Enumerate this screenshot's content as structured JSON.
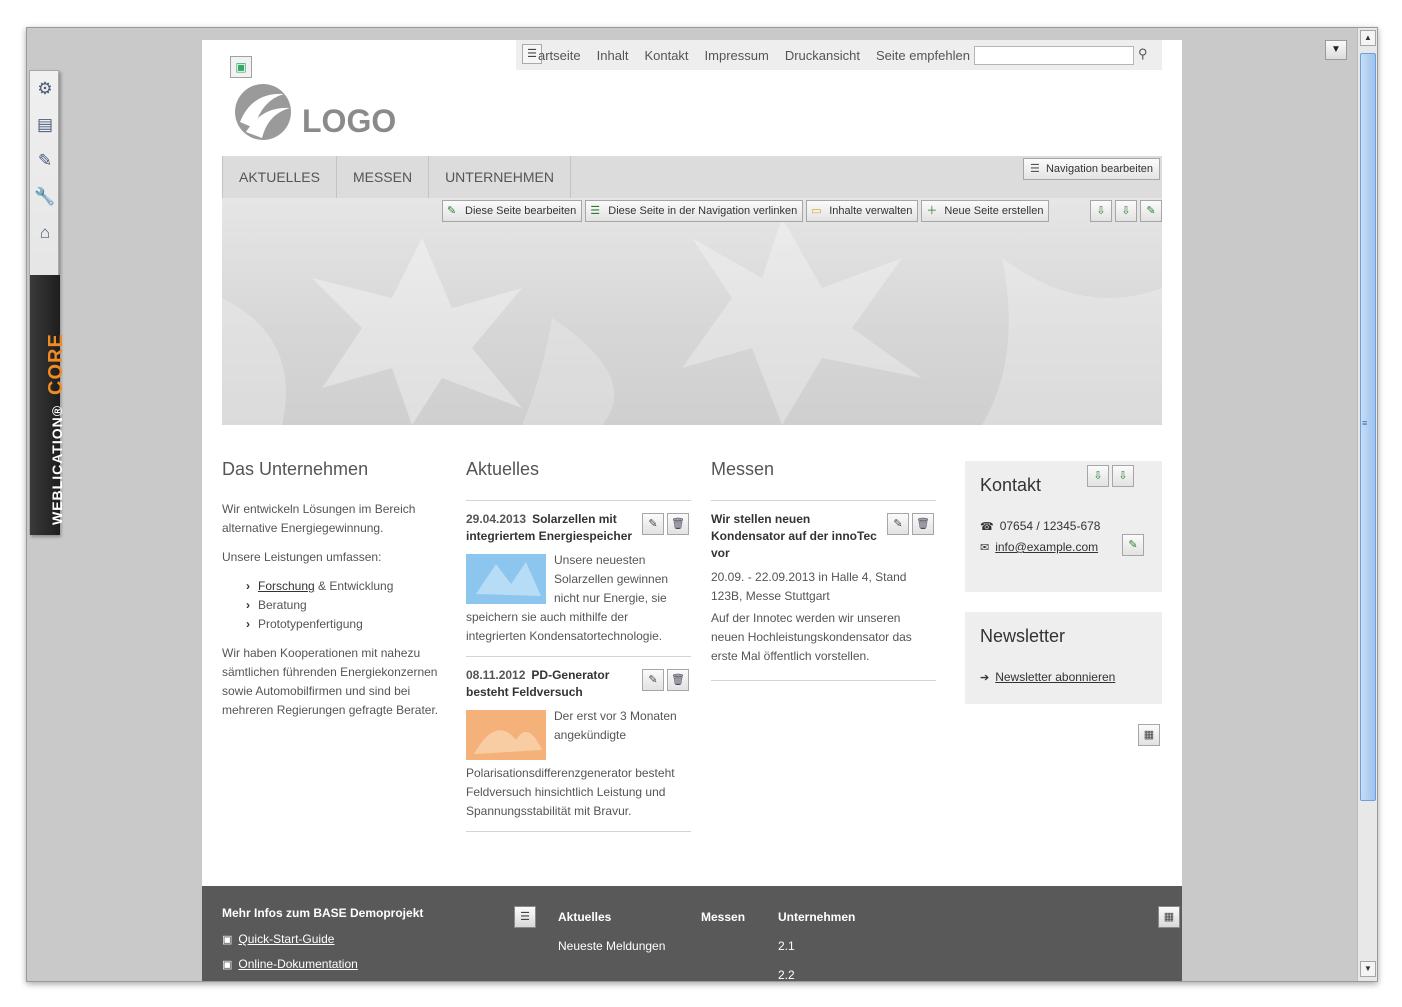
{
  "sidebar": {
    "icons": [
      "gear-icon",
      "layout-icon",
      "edit-icon",
      "wrench-icon",
      "home-icon"
    ],
    "brand_word": "WEBLICATION®",
    "brand_core": "CORE"
  },
  "metanav": {
    "links": [
      "artseite",
      "Inhalt",
      "Kontakt",
      "Impressum",
      "Druckansicht",
      "Seite empfehlen"
    ],
    "search_value": "",
    "search_placeholder": ""
  },
  "logo": {
    "text": "LOGO"
  },
  "mainnav": {
    "tabs": [
      "AKTUELLES",
      "MESSEN",
      "UNTERNEHMEN"
    ],
    "edit_label": "Navigation bearbeiten"
  },
  "edittools": {
    "edit_page": "Diese Seite bearbeiten",
    "link_nav": "Diese Seite in der Navigation verlinken",
    "manage": "Inhalte verwalten",
    "new_page": "Neue Seite erstellen"
  },
  "col1": {
    "title": "Das Unternehmen",
    "p1": "Wir entwickeln Lösungen im Bereich alternative Energiegewinnung.",
    "p2": "Unsere Leistungen umfassen:",
    "item1_link": "Forschung",
    "item1_rest": " & Entwicklung",
    "item2": "Beratung",
    "item3": "Prototypenfertigung",
    "p3": "Wir haben Kooperationen mit nahezu sämtlichen führenden Energiekonzernen sowie Automobilfirmen und sind bei mehreren Regierungen gefragte Berater."
  },
  "col2": {
    "title": "Aktuelles",
    "news": [
      {
        "date": "29.04.2013",
        "headline": "Solarzellen mit integriertem Energiespeicher",
        "text": "Unsere neuesten Solarzellen gewinnen nicht nur Energie, sie speichern sie auch mithilfe der integrierten Kondensatortechnologie."
      },
      {
        "date": "08.11.2012",
        "headline": "PD-Generator besteht Feldversuch",
        "text": "Der erst vor 3 Monaten angekündigte Polarisationsdifferenzgenerator besteht Feldversuch hinsichtlich Leistung und Spannungsstabilität mit Bravur."
      }
    ]
  },
  "col3": {
    "title": "Messen",
    "headline": "Wir stellen neuen Kondensator auf der innoTec vor",
    "sub": "20.09. - 22.09.2013 in Halle 4, Stand 123B, Messe Stuttgart",
    "text": "Auf der Innotec werden wir unseren neuen Hochleistungskondensator das erste Mal öffentlich vorstellen."
  },
  "kontakt": {
    "title": "Kontakt",
    "phone": "07654 / 12345-678",
    "email": "info@example.com"
  },
  "newsletter": {
    "title": "Newsletter",
    "link": "Newsletter abonnieren"
  },
  "footer": {
    "title": "Mehr Infos zum BASE Demoprojekt",
    "link1": "Quick-Start-Guide",
    "link2": "Online-Dokumentation",
    "h1": "Aktuelles",
    "h2": "Messen",
    "h3": "Unternehmen",
    "v1": "Neueste Meldungen",
    "v3a": "2.1",
    "v3b": "2.2"
  },
  "colors": {
    "window_bg": "#c9c9c9",
    "nav_bg": "#dcdcdc",
    "footer_bg": "#595959",
    "accent_orange": "#f08a24"
  }
}
